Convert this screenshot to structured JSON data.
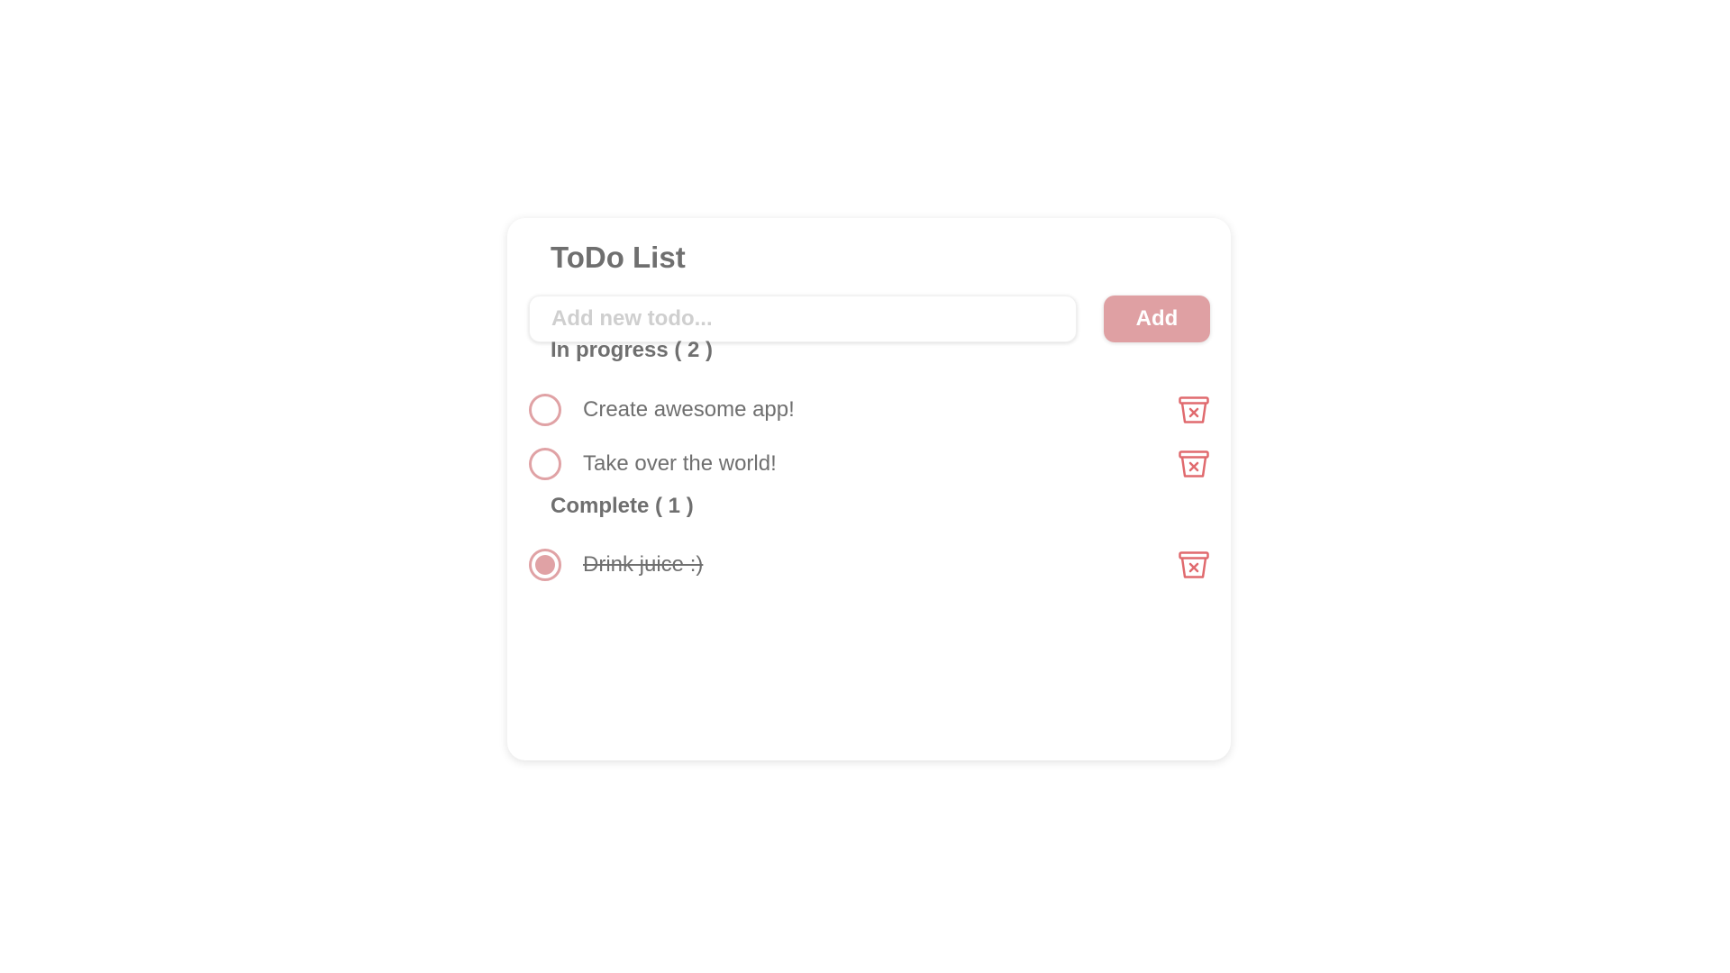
{
  "app": {
    "title": "ToDo List"
  },
  "new_todo": {
    "placeholder": "Add new todo...",
    "value": "",
    "add_label": "Add"
  },
  "sections": {
    "in_progress": {
      "heading": "In progress ( 2 )",
      "items": [
        {
          "label": "Create awesome app!",
          "completed": false
        },
        {
          "label": "Take over the world!",
          "completed": false
        }
      ]
    },
    "complete": {
      "heading": "Complete ( 1 )",
      "items": [
        {
          "label": "Drink juice :)",
          "completed": true
        }
      ]
    }
  },
  "icons": {
    "checkbox_empty": "radio-unchecked-icon",
    "checkbox_checked": "radio-checked-icon",
    "delete": "trash-icon"
  },
  "colors": {
    "accent": "#dfa0a3",
    "delete_icon": "#e06a6e",
    "text": "#6f6f6f",
    "placeholder": "#cfcfcf"
  }
}
